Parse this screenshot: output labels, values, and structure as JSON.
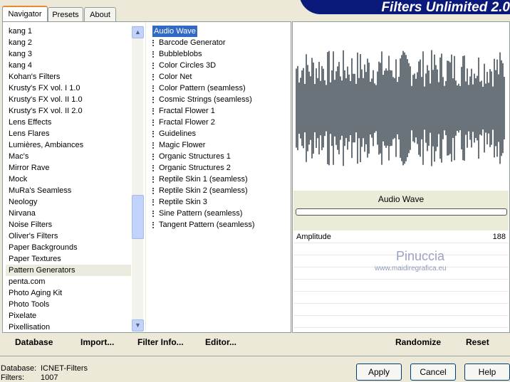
{
  "title": "Filters Unlimited 2.0",
  "tabs": [
    "Navigator",
    "Presets",
    "About"
  ],
  "categories": [
    "kang 1",
    "kang 2",
    "kang 3",
    "kang 4",
    "Kohan's Filters",
    "Krusty's FX vol. I 1.0",
    "Krusty's FX vol. II 1.0",
    "Krusty's FX vol. II 2.0",
    "Lens Effects",
    "Lens Flares",
    "Lumières, Ambiances",
    "Mac's",
    "Mirror Rave",
    "Mock",
    "MuRa's Seamless",
    "Neology",
    "Nirvana",
    "Noise Filters",
    "Oliver's Filters",
    "Paper Backgrounds",
    "Paper Textures",
    "Pattern Generators",
    "penta.com",
    "Photo Aging Kit",
    "Photo Tools",
    "Pixelate",
    "Pixellisation"
  ],
  "selected_category": "Pattern Generators",
  "filters": [
    "Audio Wave",
    "Barcode Generator",
    "Bubbleblobs",
    "Color Circles 3D",
    "Color Net",
    "Color Pattern (seamless)",
    "Cosmic Strings (seamless)",
    "Fractal Flower 1",
    "Fractal Flower 2",
    "Guidelines",
    "Magic Flower",
    "Organic Structures 1",
    "Organic Structures 2",
    "Reptile Skin 1 (seamless)",
    "Reptile Skin 2 (seamless)",
    "Reptile Skin 3",
    "Sine Pattern (seamless)",
    "Tangent Pattern (seamless)"
  ],
  "selected_filter": "Audio Wave",
  "preview": {
    "filter_name": "Audio Wave",
    "wave_color": "#1a2633"
  },
  "params": [
    {
      "label": "Amplitude",
      "value": "188"
    }
  ],
  "watermark": {
    "name": "Pinuccia",
    "url": "www.maidiregrafica.eu"
  },
  "bottom": {
    "database": "Database",
    "import": "Import...",
    "filter_info": "Filter Info...",
    "editor": "Editor...",
    "randomize": "Randomize",
    "reset": "Reset"
  },
  "status": {
    "database_label": "Database:",
    "database_value": "ICNET-Filters",
    "filters_label": "Filters:",
    "filters_value": "1007"
  },
  "buttons": {
    "apply": "Apply",
    "cancel": "Cancel",
    "help": "Help"
  }
}
